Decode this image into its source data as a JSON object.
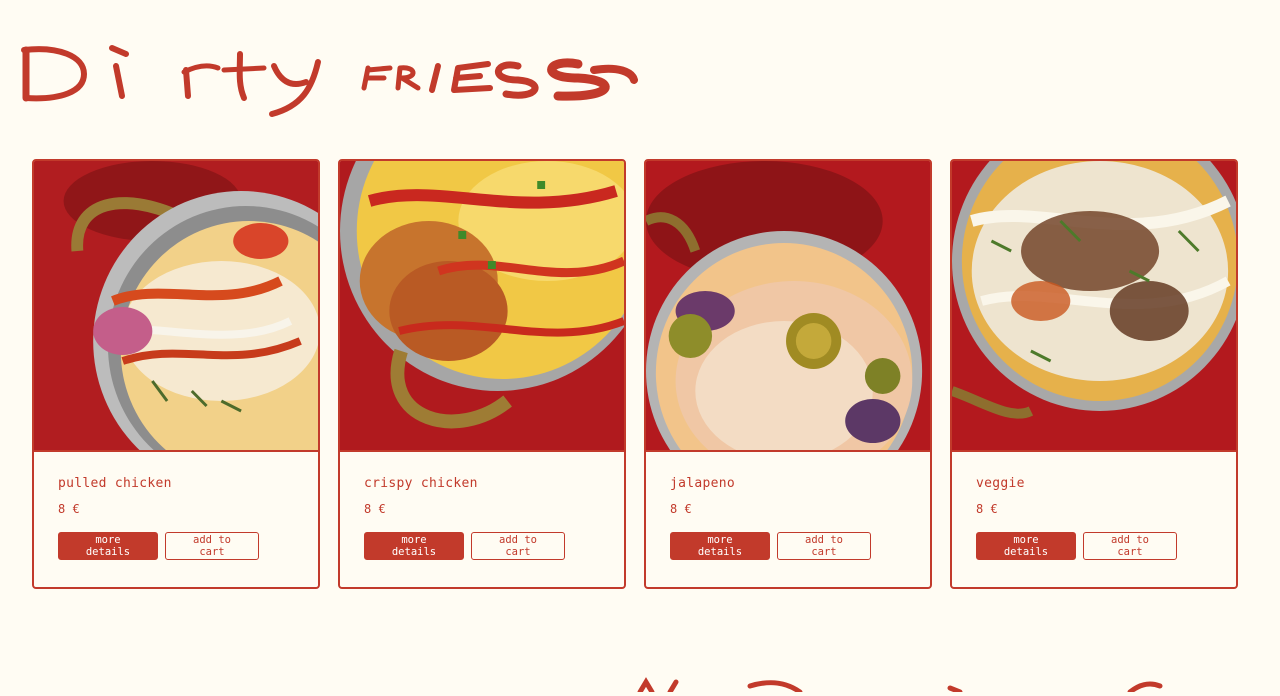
{
  "brand": {
    "logo_text": "Dirty fries",
    "accent_color": "#c23a2b",
    "background_color": "#fffcf3"
  },
  "products": [
    {
      "name": "pulled chicken",
      "price": "8 €",
      "details_label": "more details",
      "cart_label": "add to cart",
      "image_alt": "pulled chicken fries in a brass pan on red background"
    },
    {
      "name": "crispy chicken",
      "price": "8 €",
      "details_label": "more details",
      "cart_label": "add to cart",
      "image_alt": "crispy chicken fries with cheese sauce on red background"
    },
    {
      "name": "jalapeno",
      "price": "8 €",
      "details_label": "more details",
      "cart_label": "add to cart",
      "image_alt": "jalapeno fries with grated cheese on red background"
    },
    {
      "name": "veggie",
      "price": "8 €",
      "details_label": "more details",
      "cart_label": "add to cart",
      "image_alt": "veggie fries with herbs and sauce on red background"
    }
  ]
}
